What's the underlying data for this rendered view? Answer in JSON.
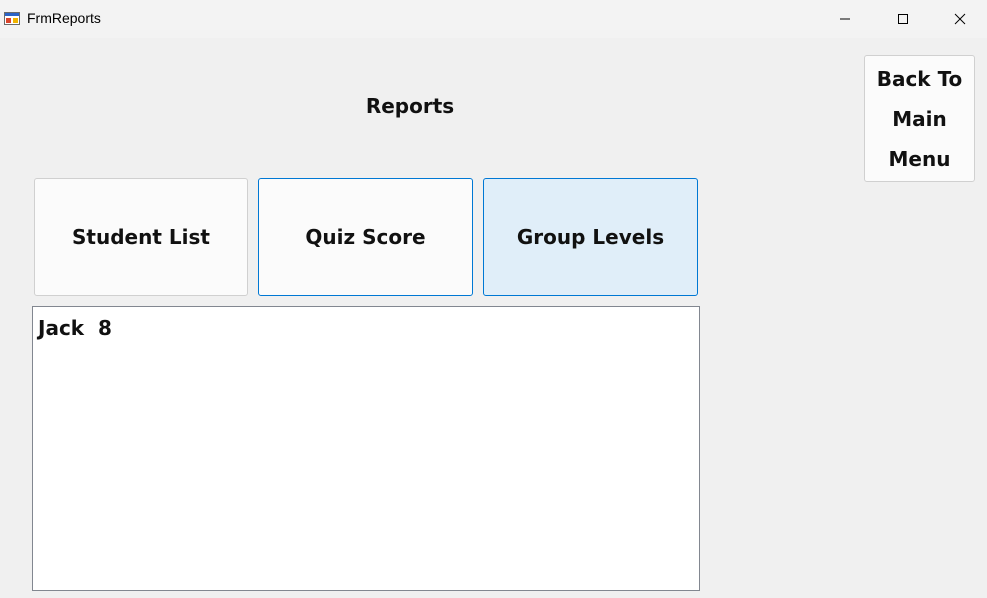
{
  "window": {
    "title": "FrmReports",
    "icon": "form-app-icon",
    "controls": [
      "minimize-icon",
      "maximize-icon",
      "close-icon"
    ]
  },
  "main": {
    "heading": "Reports",
    "buttons": {
      "student_list": "Student List",
      "quiz_score": "Quiz Score",
      "group_levels": "Group Levels",
      "back_to_main_menu": "Back To Main Menu"
    },
    "listbox": {
      "items": [
        "Jack  8"
      ]
    }
  },
  "colors": {
    "accent": "#0078d4",
    "selected_button_bg": "#e0eef9",
    "window_bg": "#f0f0f0"
  }
}
